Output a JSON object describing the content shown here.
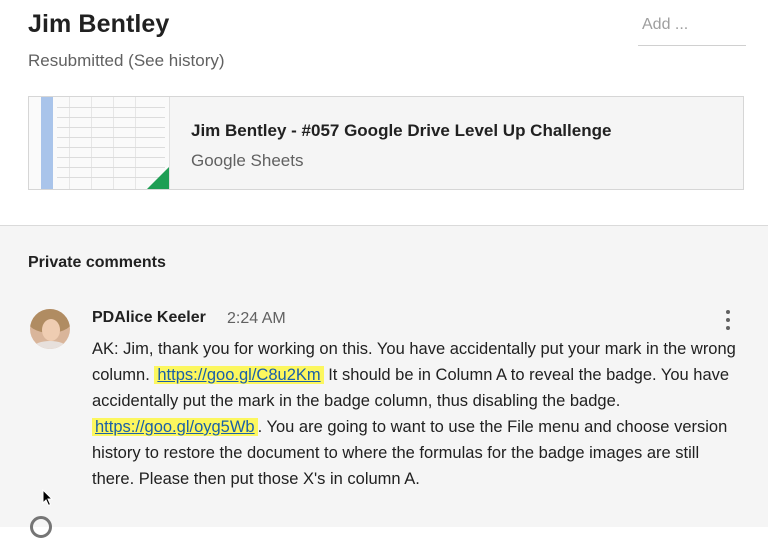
{
  "student": {
    "name": "Jim Bentley",
    "status": "Resubmitted",
    "history_link": "(See history)"
  },
  "grade": {
    "placeholder": "Add ..."
  },
  "attachment": {
    "title": "Jim Bentley - #057 Google Drive Level Up Challenge",
    "type": "Google Sheets",
    "icon": "google-sheets-thumbnail",
    "accent_color": "#1e9e54"
  },
  "private_comments": {
    "section_title": "Private comments",
    "comment": {
      "author": "PDAlice Keeler",
      "time": "2:24 AM",
      "text_1": "AK: Jim, thank you for working on this. You have accidentally put your mark in the wrong column. ",
      "link_1": "https://goo.gl/C8u2Km",
      "text_2": " It should be in Column A to reveal the badge. You have accidentally put the mark in the badge column, thus disabling the badge. ",
      "link_2": "https://goo.gl/oyg5Wb",
      "text_3": ". You are going to want to use the File menu and choose version history to restore the document to where the formulas for the badge images are still there. Please then put those X's in column A.",
      "highlight_color": "#fcf75e"
    }
  }
}
